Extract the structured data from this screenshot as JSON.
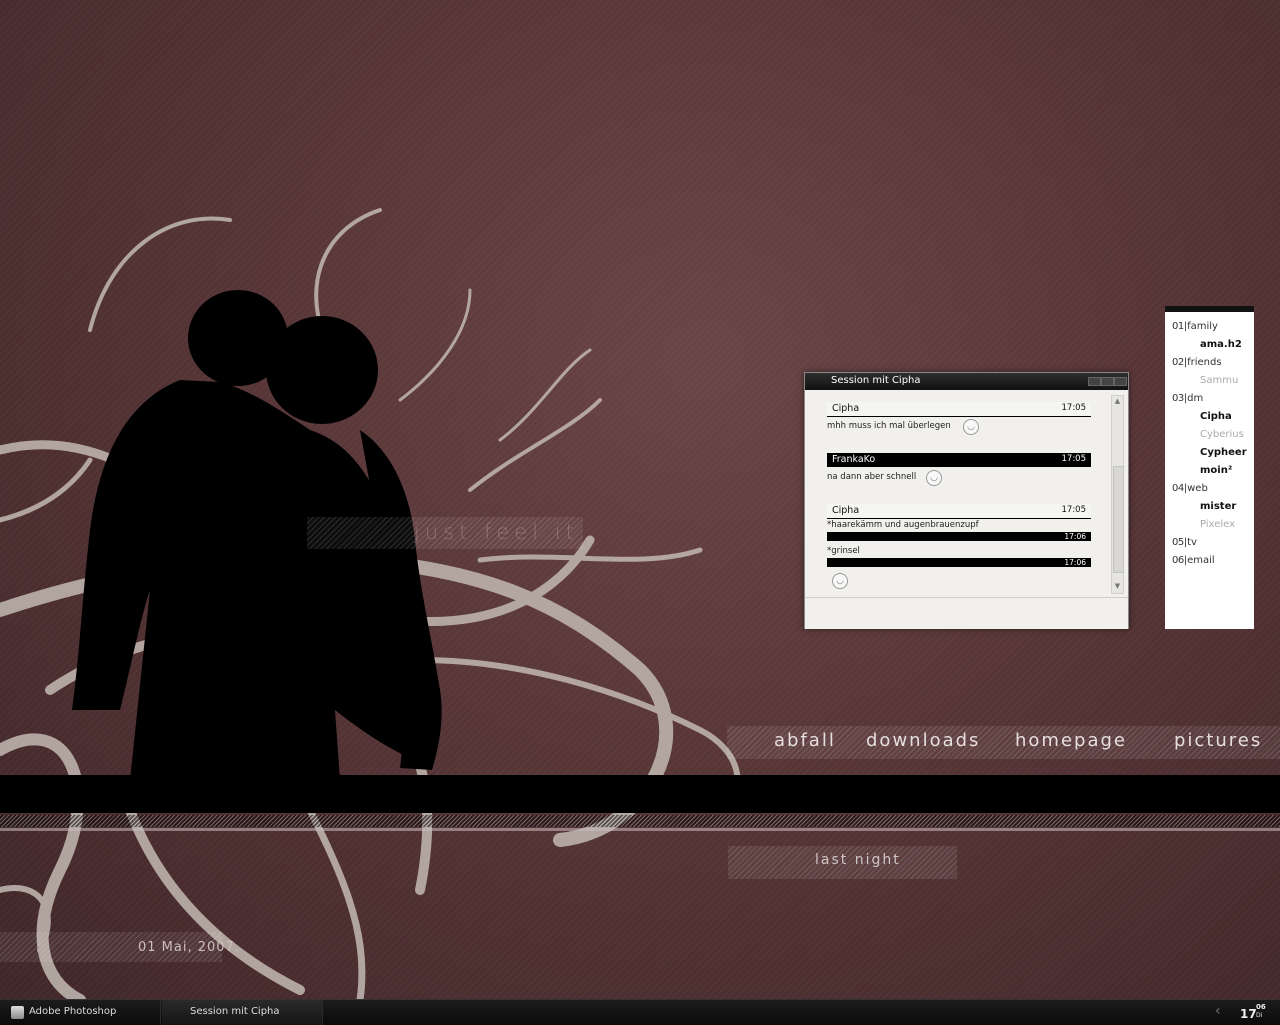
{
  "wallpaper": {
    "tagline": "just feel it",
    "nav": [
      "abfall",
      "downloads",
      "homepage",
      "pictures"
    ],
    "last_night": "last night",
    "date": "01 Mai, 2007."
  },
  "chat": {
    "title": "Session mit Cipha",
    "messages": [
      {
        "sender": "Cipha",
        "time": "17:05",
        "text": "mhh muss ich mal überlegen"
      },
      {
        "sender": "FrankaKo",
        "time": "17:05",
        "text": "na dann aber schnell"
      },
      {
        "sender": "Cipha",
        "time": "17:05",
        "text": "*haarekämm und augenbrauenzupf"
      }
    ],
    "extra_time_1": "17:06",
    "extra_text": "*grinsel",
    "extra_time_2": "17:06"
  },
  "contacts": {
    "groups": [
      {
        "num": "01",
        "name": "family",
        "members": [
          {
            "name": "ama.h2",
            "online": true
          }
        ]
      },
      {
        "num": "02",
        "name": "friends",
        "members": [
          {
            "name": "Sammu",
            "online": false
          }
        ]
      },
      {
        "num": "03",
        "name": "dm",
        "members": [
          {
            "name": "Cipha",
            "online": true
          },
          {
            "name": "Cyberius",
            "online": false
          },
          {
            "name": "Cypheer",
            "online": true
          },
          {
            "name": "moin²",
            "online": true
          }
        ]
      },
      {
        "num": "04",
        "name": "web",
        "members": [
          {
            "name": "mister",
            "online": true
          },
          {
            "name": "Pixelex",
            "online": false
          }
        ]
      },
      {
        "num": "05",
        "name": "tv",
        "members": []
      },
      {
        "num": "06",
        "name": "email",
        "members": []
      }
    ]
  },
  "taskbar": {
    "items": [
      "Adobe Photoshop",
      "Session mit Cipha"
    ],
    "clock_hour": "17",
    "clock_minute": "06",
    "clock_day": "Di"
  }
}
